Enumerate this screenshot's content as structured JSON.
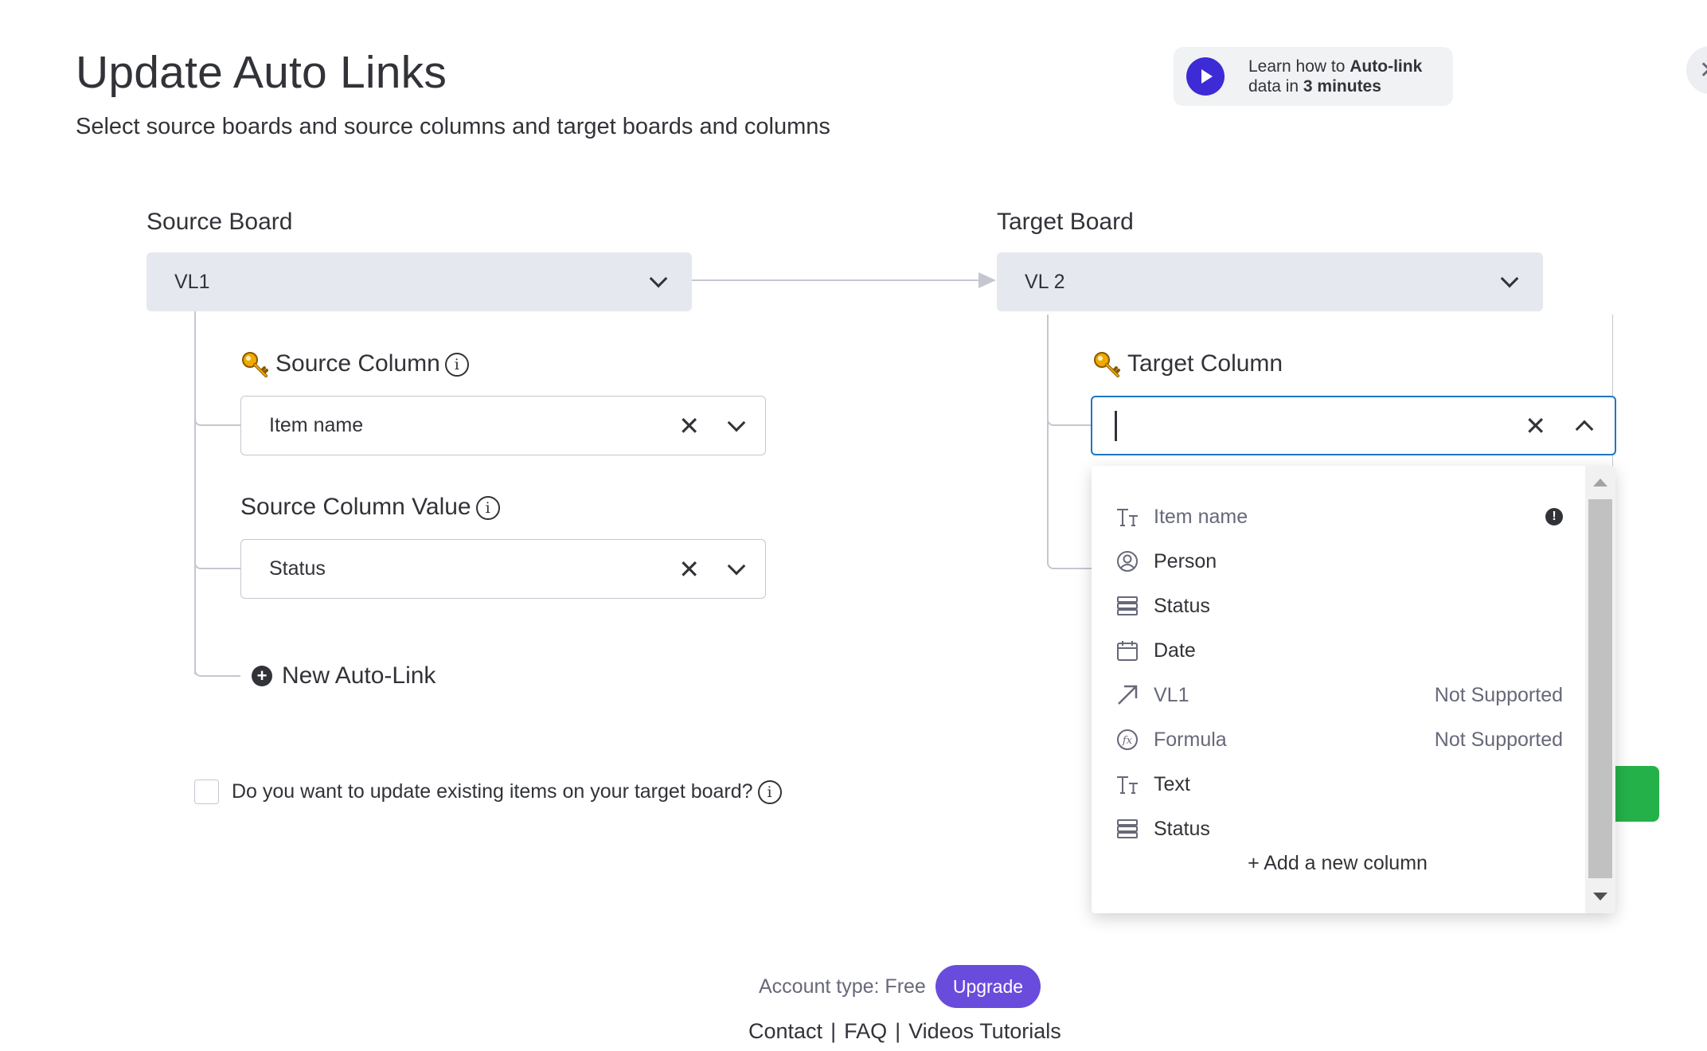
{
  "header": {
    "title": "Update Auto Links",
    "subtitle": "Select source boards and source columns and target boards and columns"
  },
  "learn": {
    "line1_prefix": "Learn how to ",
    "line1_bold": "Auto-link",
    "line2_prefix": "data in ",
    "line2_bold": "3 minutes"
  },
  "close_label": "✕",
  "source": {
    "board_label": "Source Board",
    "board_value": "VL1",
    "column_label": "Source Column",
    "column_value": "Item name",
    "value_label": "Source Column Value",
    "value_value": "Status"
  },
  "target": {
    "board_label": "Target Board",
    "board_value": "VL 2",
    "column_label": "Target Column"
  },
  "new_auto_link": "New Auto-Link",
  "update_existing": "Do you want to update existing items on your target board?",
  "info_glyph": "i",
  "dropdown": {
    "items": [
      {
        "label": "Item name",
        "icon": "text-type-icon",
        "note": "",
        "disabled": true
      },
      {
        "label": "Person",
        "icon": "person-icon",
        "note": "",
        "disabled": false
      },
      {
        "label": "Status",
        "icon": "status-icon",
        "note": "",
        "disabled": false
      },
      {
        "label": "Date",
        "icon": "calendar-icon",
        "note": "",
        "disabled": false
      },
      {
        "label": "VL1",
        "icon": "link-arrow-icon",
        "note": "Not Supported",
        "disabled": true
      },
      {
        "label": "Formula",
        "icon": "formula-icon",
        "note": "Not Supported",
        "disabled": true
      },
      {
        "label": "Text",
        "icon": "text-type-icon",
        "note": "",
        "disabled": false
      },
      {
        "label": "Status",
        "icon": "status-icon",
        "note": "",
        "disabled": false
      }
    ],
    "add_new": "+ Add a new column"
  },
  "footer": {
    "account_type": "Account type: Free",
    "upgrade": "Upgrade",
    "contact": "Contact",
    "faq": "FAQ",
    "videos": "Videos Tutorials",
    "separator": "|"
  },
  "colors": {
    "accent_blue": "#1f76c2",
    "play_purple": "#3d2bd6",
    "upgrade_purple": "#6a4cdc",
    "green": "#25b14a"
  }
}
